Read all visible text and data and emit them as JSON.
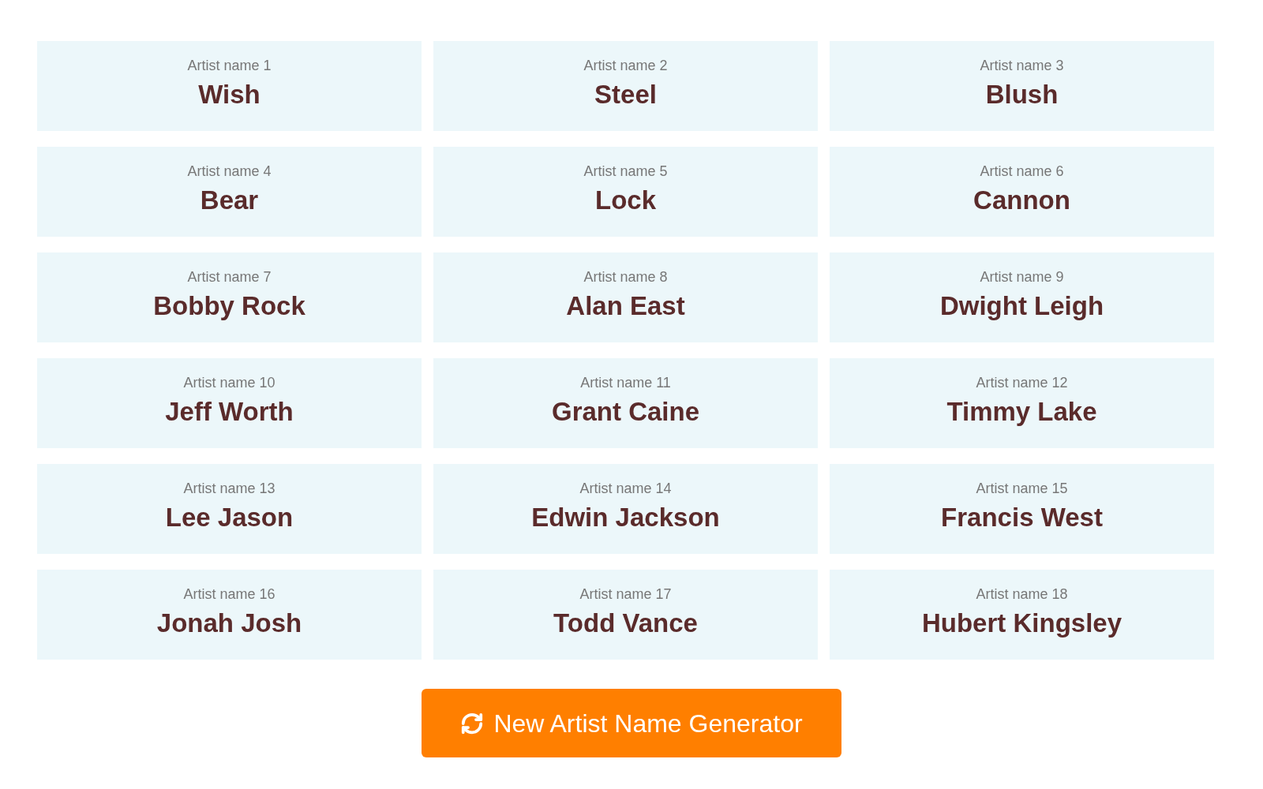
{
  "names": [
    {
      "label": "Artist name 1",
      "name": "Wish"
    },
    {
      "label": "Artist name 2",
      "name": "Steel"
    },
    {
      "label": "Artist name 3",
      "name": "Blush"
    },
    {
      "label": "Artist name 4",
      "name": "Bear"
    },
    {
      "label": "Artist name 5",
      "name": "Lock"
    },
    {
      "label": "Artist name 6",
      "name": "Cannon"
    },
    {
      "label": "Artist name 7",
      "name": "Bobby Rock"
    },
    {
      "label": "Artist name 8",
      "name": "Alan East"
    },
    {
      "label": "Artist name 9",
      "name": "Dwight Leigh"
    },
    {
      "label": "Artist name 10",
      "name": "Jeff Worth"
    },
    {
      "label": "Artist name 11",
      "name": "Grant Caine"
    },
    {
      "label": "Artist name 12",
      "name": "Timmy Lake"
    },
    {
      "label": "Artist name 13",
      "name": "Lee Jason"
    },
    {
      "label": "Artist name 14",
      "name": "Edwin Jackson"
    },
    {
      "label": "Artist name 15",
      "name": "Francis West"
    },
    {
      "label": "Artist name 16",
      "name": "Jonah Josh"
    },
    {
      "label": "Artist name 17",
      "name": "Todd Vance"
    },
    {
      "label": "Artist name 18",
      "name": "Hubert Kingsley"
    }
  ],
  "button": {
    "label": "New Artist Name Generator"
  }
}
